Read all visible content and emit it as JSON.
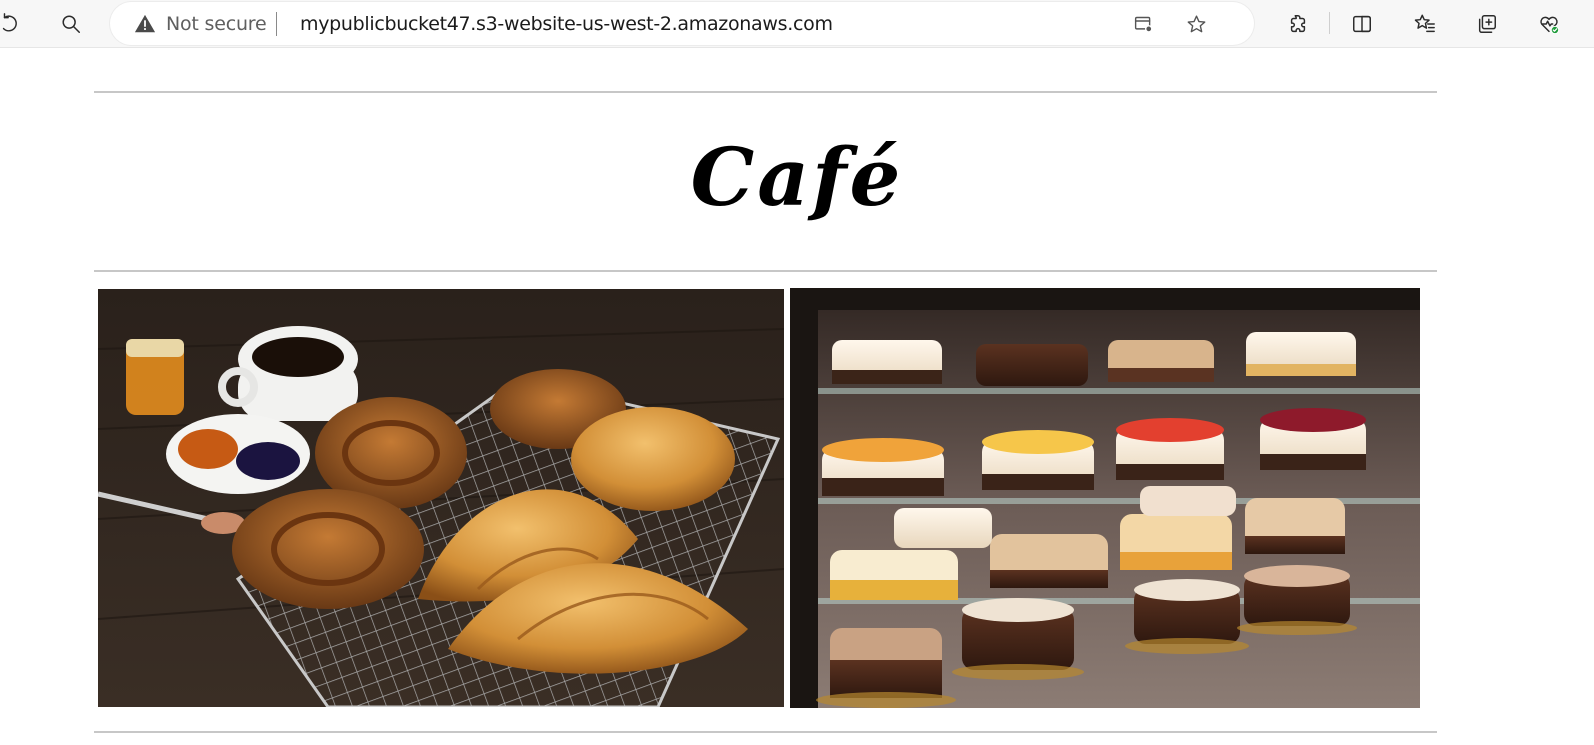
{
  "browser": {
    "security_label": "Not secure",
    "url": "mypublicbucket47.s3-website-us-west-2.amazonaws.com",
    "icons": [
      "refresh-icon",
      "search-icon",
      "warning-icon",
      "app-available-icon",
      "favorite-star-icon",
      "extensions-icon",
      "split-screen-icon",
      "favorites-icon",
      "collections-icon",
      "browser-essentials-icon"
    ]
  },
  "page": {
    "title": "Café",
    "images": [
      {
        "name": "pastries-photo",
        "subject": "pastries-and-coffee"
      },
      {
        "name": "cakes-photo",
        "subject": "cake-display-case"
      }
    ]
  },
  "colors": {
    "toolbar_bg": "#f7f7f7",
    "rule": "#c7c7c7",
    "title": "#000000",
    "heart_badge": "#1e9b3a"
  }
}
